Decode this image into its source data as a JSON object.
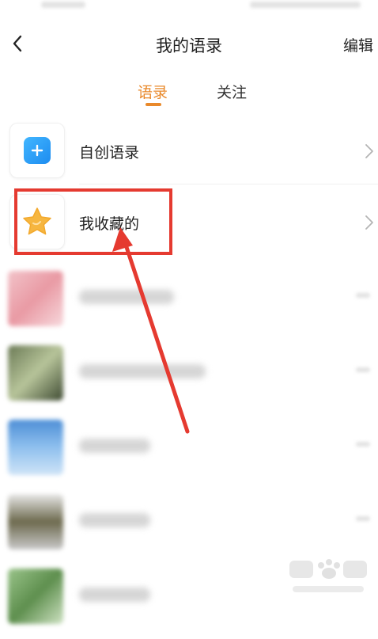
{
  "header": {
    "back_icon": "chevron-left-icon",
    "title": "我的语录",
    "edit_label": "编辑"
  },
  "tabs": [
    {
      "label": "语录",
      "active": true
    },
    {
      "label": "关注",
      "active": false
    }
  ],
  "list": {
    "items": [
      {
        "label": "自创语录",
        "icon": "plus-icon"
      },
      {
        "label": "我收藏的",
        "icon": "star-icon"
      }
    ]
  },
  "colors": {
    "accent": "#e9892b",
    "highlight": "#e53a30",
    "plus_icon_bg": "#1d8cf0",
    "star_icon": "#f6b640"
  }
}
